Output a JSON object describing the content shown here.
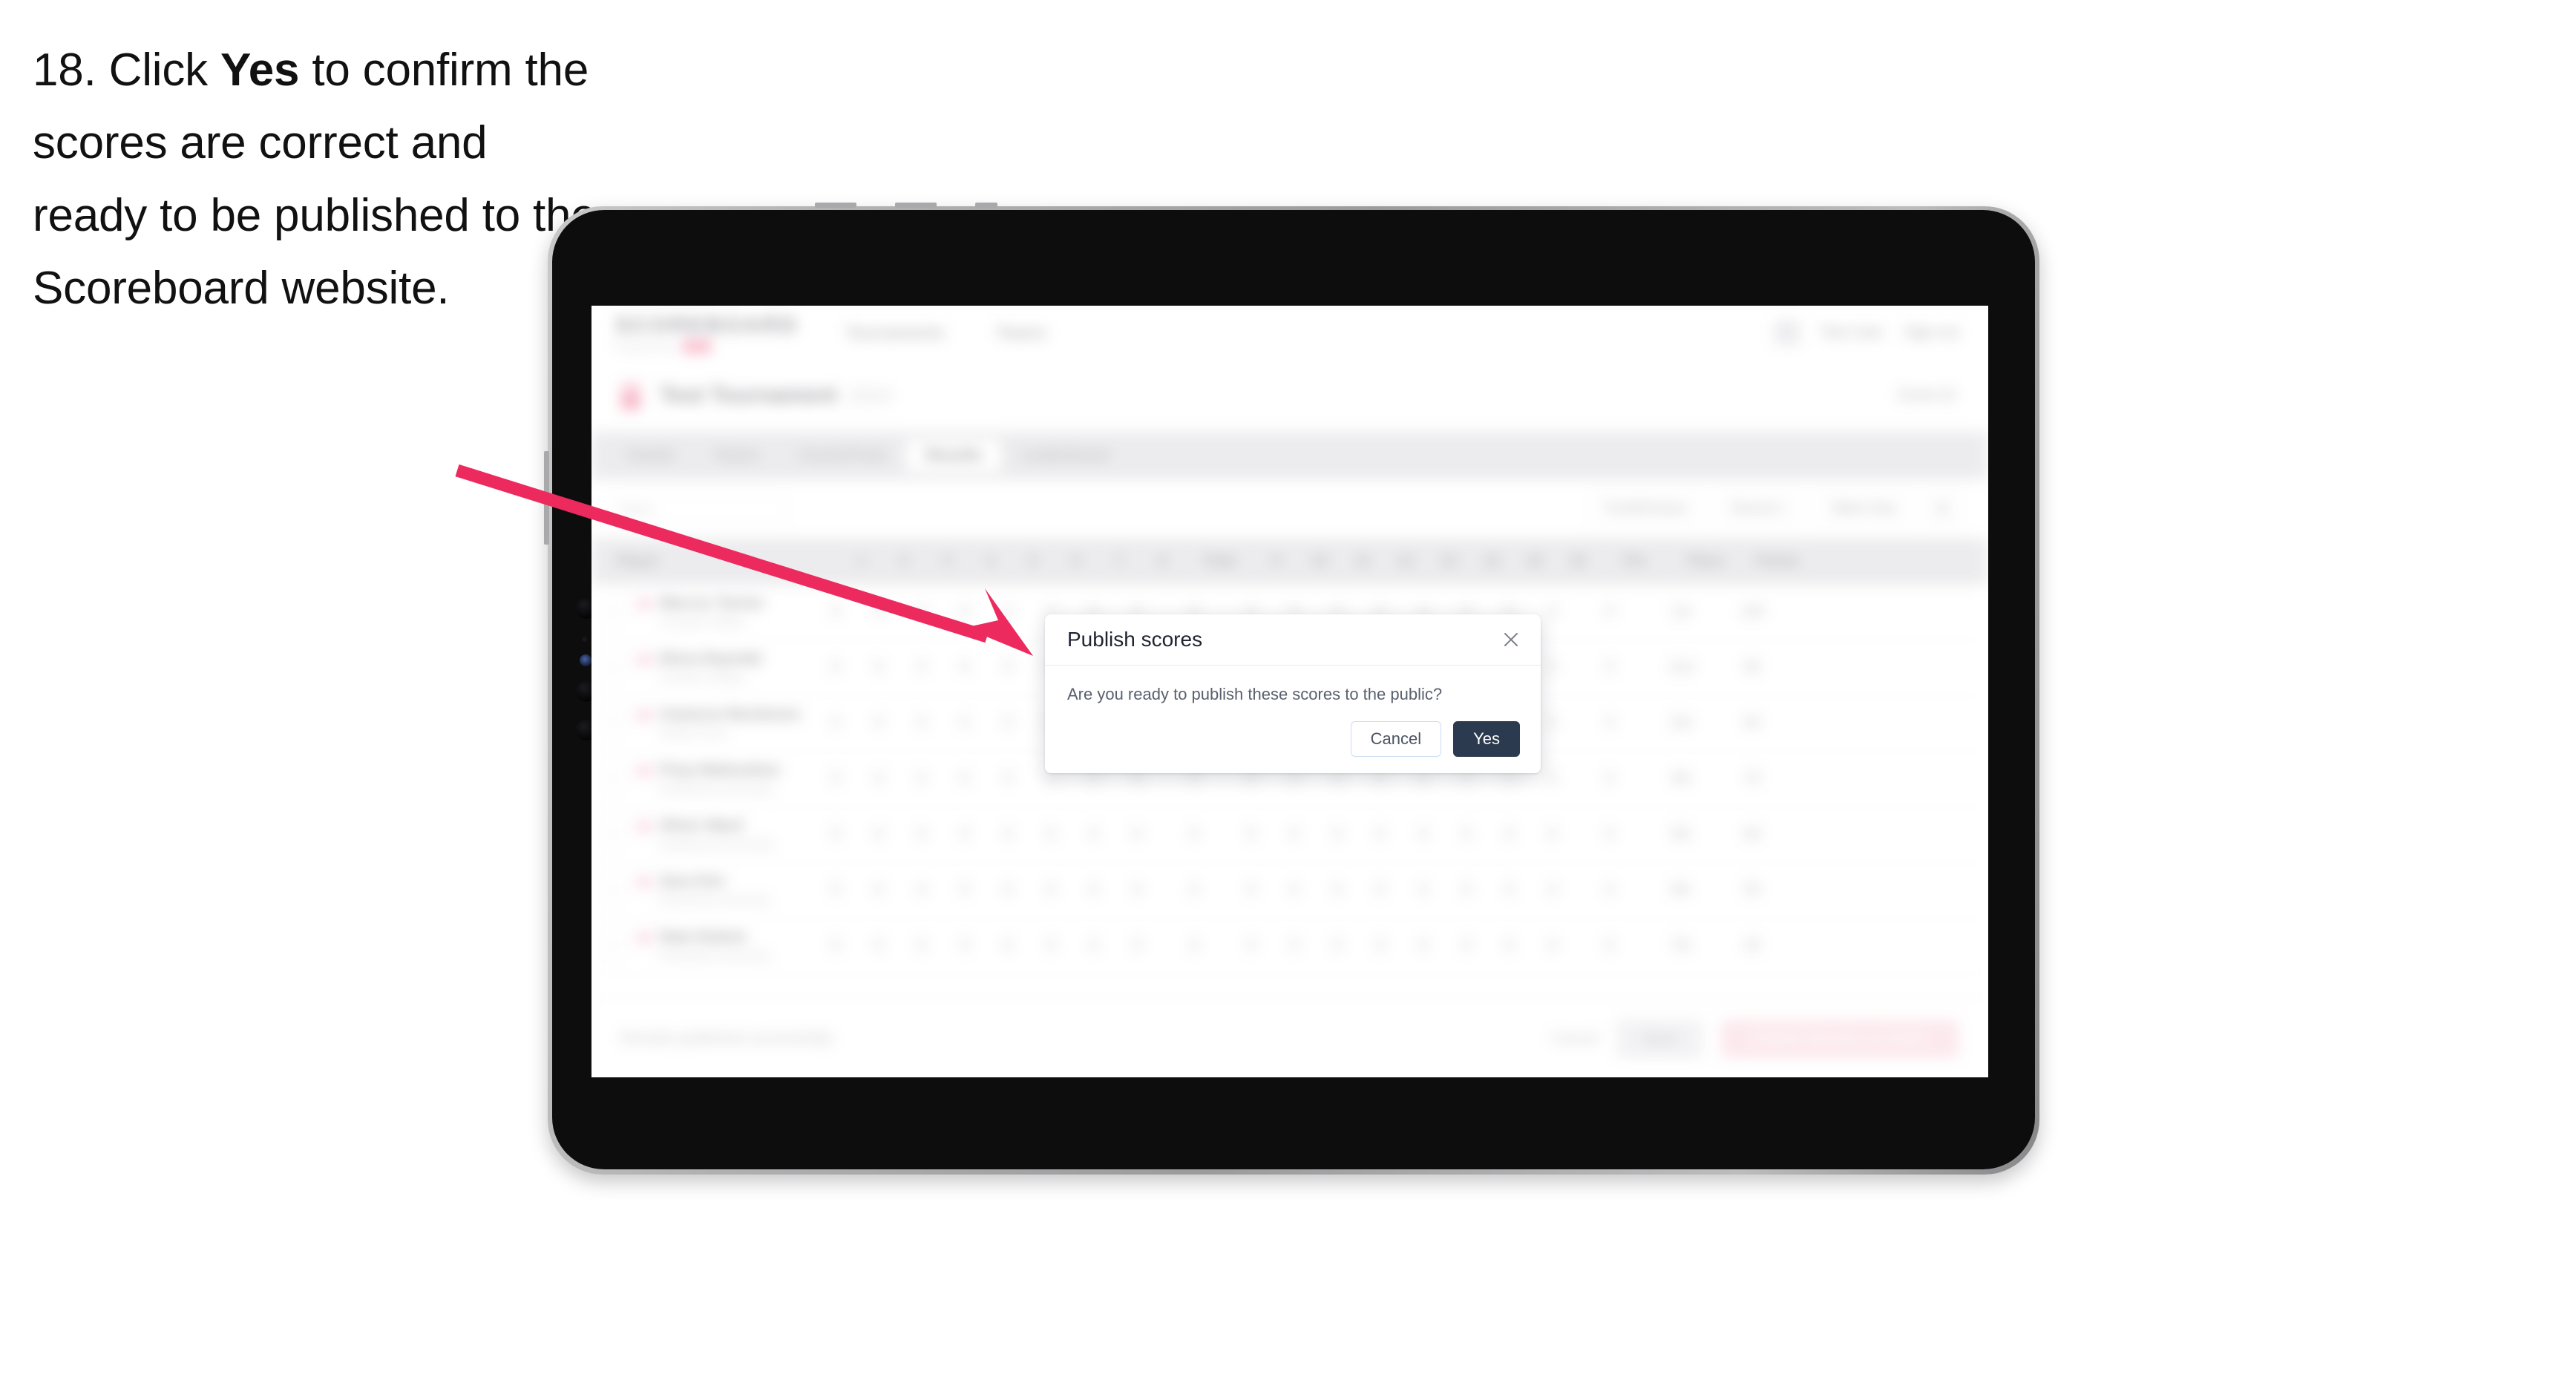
{
  "instruction": {
    "step_number": "18.",
    "text_before": "Click",
    "emphasis": "Yes",
    "text_after": "to confirm the scores are correct and ready to be published to the Scoreboard website."
  },
  "colors": {
    "arrow": "#ed2a5e",
    "brand_accent": "#ed2a5e",
    "primary_button": "#2b3a4e",
    "cancel_border": "#cfdcf2",
    "tab_bar": "#d3d3d8"
  },
  "modal": {
    "title": "Publish scores",
    "body": "Are you ready to publish these scores to the public?",
    "cancel_label": "Cancel",
    "confirm_label": "Yes",
    "close_icon": "close-icon"
  },
  "app": {
    "brand": {
      "wordmark": "SCOREBOARD",
      "subword": "Powered by",
      "pill": "SM"
    },
    "topnav": [
      "Tournaments",
      "Teams"
    ],
    "topbar_right": {
      "avatar": "avatar",
      "user": "Test User",
      "signout": "Sign out"
    },
    "event": {
      "name": "Test Tournament",
      "subtitle": "2024",
      "right_link": "Event ID"
    },
    "tabs": [
      {
        "label": "Details",
        "active": false
      },
      {
        "label": "Teams",
        "active": false
      },
      {
        "label": "Courts/Pools",
        "active": false
      },
      {
        "label": "Results",
        "active": true
      },
      {
        "label": "Leaderboard",
        "active": false
      }
    ],
    "filters": {
      "search_placeholder": "Search",
      "controls": [
        "Pool/Division",
        "Round 1",
        "Table Only"
      ]
    },
    "table": {
      "headers": [
        "Player",
        "1",
        "2",
        "3",
        "4",
        "5",
        "6",
        "7",
        "8",
        "Total",
        "9",
        "10",
        "11",
        "12",
        "13",
        "14",
        "15",
        "16",
        "Pts",
        "Place",
        "Points"
      ],
      "rows": [
        {
          "name": "Marcus Tanner",
          "club": "Coastal College",
          "cells": [
            "0",
            "0",
            "0",
            "0",
            "0",
            "0",
            "0",
            "0",
            "0",
            "0",
            "0",
            "0",
            "0",
            "0",
            "0",
            "0",
            "0",
            "0"
          ],
          "place": "1st",
          "points": "100"
        },
        {
          "name": "Elena Rayndal",
          "club": "Coastal College",
          "cells": [
            "0",
            "0",
            "0",
            "0",
            "0",
            "0",
            "0",
            "0",
            "0",
            "0",
            "0",
            "0",
            "0",
            "0",
            "0",
            "0",
            "0",
            "0"
          ],
          "place": "2nd",
          "points": "90"
        },
        {
          "name": "Cameron Beckmore",
          "club": "Harbor Point",
          "cells": [
            "0",
            "0",
            "0",
            "0",
            "0",
            "0",
            "0",
            "0",
            "0",
            "0",
            "0",
            "0",
            "0",
            "0",
            "0",
            "0",
            "0",
            "0"
          ],
          "place": "3rd",
          "points": "80"
        },
        {
          "name": "Priya Mahendran",
          "club": "Northwood University",
          "cells": [
            "0",
            "0",
            "0",
            "0",
            "0",
            "0",
            "0",
            "0",
            "0",
            "0",
            "0",
            "0",
            "0",
            "0",
            "0",
            "0",
            "0",
            "0"
          ],
          "place": "4th",
          "points": "70"
        },
        {
          "name": "Oliver Ward",
          "club": "Northwood University",
          "cells": [
            "0",
            "0",
            "0",
            "0",
            "0",
            "0",
            "0",
            "0",
            "0",
            "0",
            "0",
            "0",
            "0",
            "0",
            "0",
            "0",
            "0",
            "0"
          ],
          "place": "5th",
          "points": "60"
        },
        {
          "name": "Sara Kim",
          "club": "Riverbend University",
          "cells": [
            "0",
            "0",
            "0",
            "0",
            "0",
            "0",
            "0",
            "0",
            "0",
            "0",
            "0",
            "0",
            "0",
            "0",
            "0",
            "0",
            "0",
            "0"
          ],
          "place": "6th",
          "points": "50"
        },
        {
          "name": "Nate Dubois",
          "club": "Riverbend University",
          "cells": [
            "0",
            "0",
            "0",
            "0",
            "0",
            "0",
            "0",
            "0",
            "0",
            "0",
            "0",
            "0",
            "0",
            "0",
            "0",
            "0",
            "0",
            "0"
          ],
          "place": "7th",
          "points": "40"
        }
      ]
    },
    "footer": {
      "note": "Results published successfully",
      "text_button": "Cancel",
      "gray_button": "Save",
      "pink_button": "Publish Results to Public"
    }
  },
  "device": {
    "type": "tablet",
    "orientation": "landscape"
  }
}
